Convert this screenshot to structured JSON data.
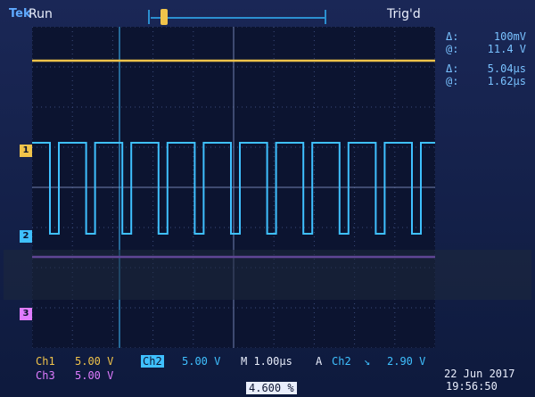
{
  "header": {
    "brand": "Tek",
    "run_state": "Run",
    "trigger_state": "Trig'd"
  },
  "readouts": [
    {
      "sym": "Δ:",
      "value": "100mV"
    },
    {
      "sym": "@:",
      "value": "11.4 V"
    },
    {
      "sym": "Δ:",
      "value": "5.04μs"
    },
    {
      "sym": "@:",
      "value": "1.62μs"
    }
  ],
  "channels": {
    "ch1_marker": "1",
    "ch2_marker": "2",
    "ch3_marker": "3"
  },
  "status": {
    "ch1_label": "Ch1",
    "ch1_scale": "5.00 V",
    "ch2_label": "Ch2",
    "ch2_scale": "5.00 V",
    "timebase": "M 1.00μs",
    "trigger_mode": "A",
    "trigger_source": "Ch2",
    "trigger_slope": "↘",
    "trigger_level": "2.90 V",
    "ch3_label": "Ch3",
    "ch3_scale": "5.00 V",
    "duty": "4.600 %",
    "date": "22 Jun  2017",
    "time": "19:56:50"
  },
  "colors": {
    "ch1": "#f0c34a",
    "ch2": "#3fc0ff",
    "ch3": "#b06cff",
    "grid": "#3a4a7a"
  }
}
